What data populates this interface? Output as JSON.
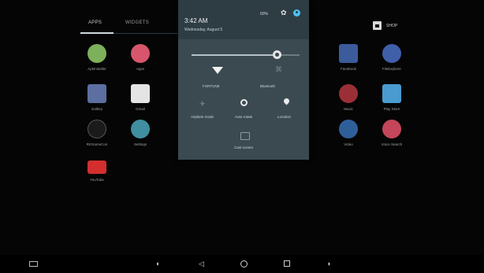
{
  "tabs": {
    "apps": "APPS",
    "widgets": "WIDGETS"
  },
  "shop": {
    "label": "SHOP"
  },
  "apps": [
    {
      "label": "ApkInstaller",
      "icon": "apk-installer-icon",
      "color": "#7db05a"
    },
    {
      "label": "Apps",
      "icon": "apps-icon",
      "color": "#d7566b"
    },
    {
      "label": "Facebook",
      "icon": "facebook-icon",
      "color": "#3b5b9a"
    },
    {
      "label": "FileExplorer",
      "icon": "folder-icon",
      "color": "#3f5fa8"
    },
    {
      "label": "Gallery",
      "icon": "gallery-icon",
      "color": "#5c6fa0"
    },
    {
      "label": "Gmail",
      "icon": "gmail-icon",
      "color": "#e4e4e4"
    },
    {
      "label": "Music",
      "icon": "music-icon",
      "color": "#9b2f36"
    },
    {
      "label": "Play Store",
      "icon": "play-store-icon",
      "color": "#4a9bd0"
    },
    {
      "label": "RKGameCon",
      "icon": "gamepad-icon",
      "color": "#1b1b1b"
    },
    {
      "label": "Settings",
      "icon": "gear-icon",
      "color": "#3f8fa0"
    },
    {
      "label": "Video",
      "icon": "video-icon",
      "color": "#2f5f9a"
    },
    {
      "label": "Voice Search",
      "icon": "microphone-icon",
      "color": "#c3465a"
    },
    {
      "label": "YouTube",
      "icon": "youtube-icon",
      "color": "#d32f2f"
    }
  ],
  "shade": {
    "time": "3:42 AM",
    "date": "Wednesday, August 5",
    "battery": "60%",
    "brightness_level": 0.79,
    "tiles": {
      "wifi": "FORTUNE",
      "bluetooth": "Bluetooth",
      "airplane": "Airplane mode",
      "auto_rotate": "Auto-rotate",
      "location": "Location",
      "cast": "Cast screen"
    }
  }
}
